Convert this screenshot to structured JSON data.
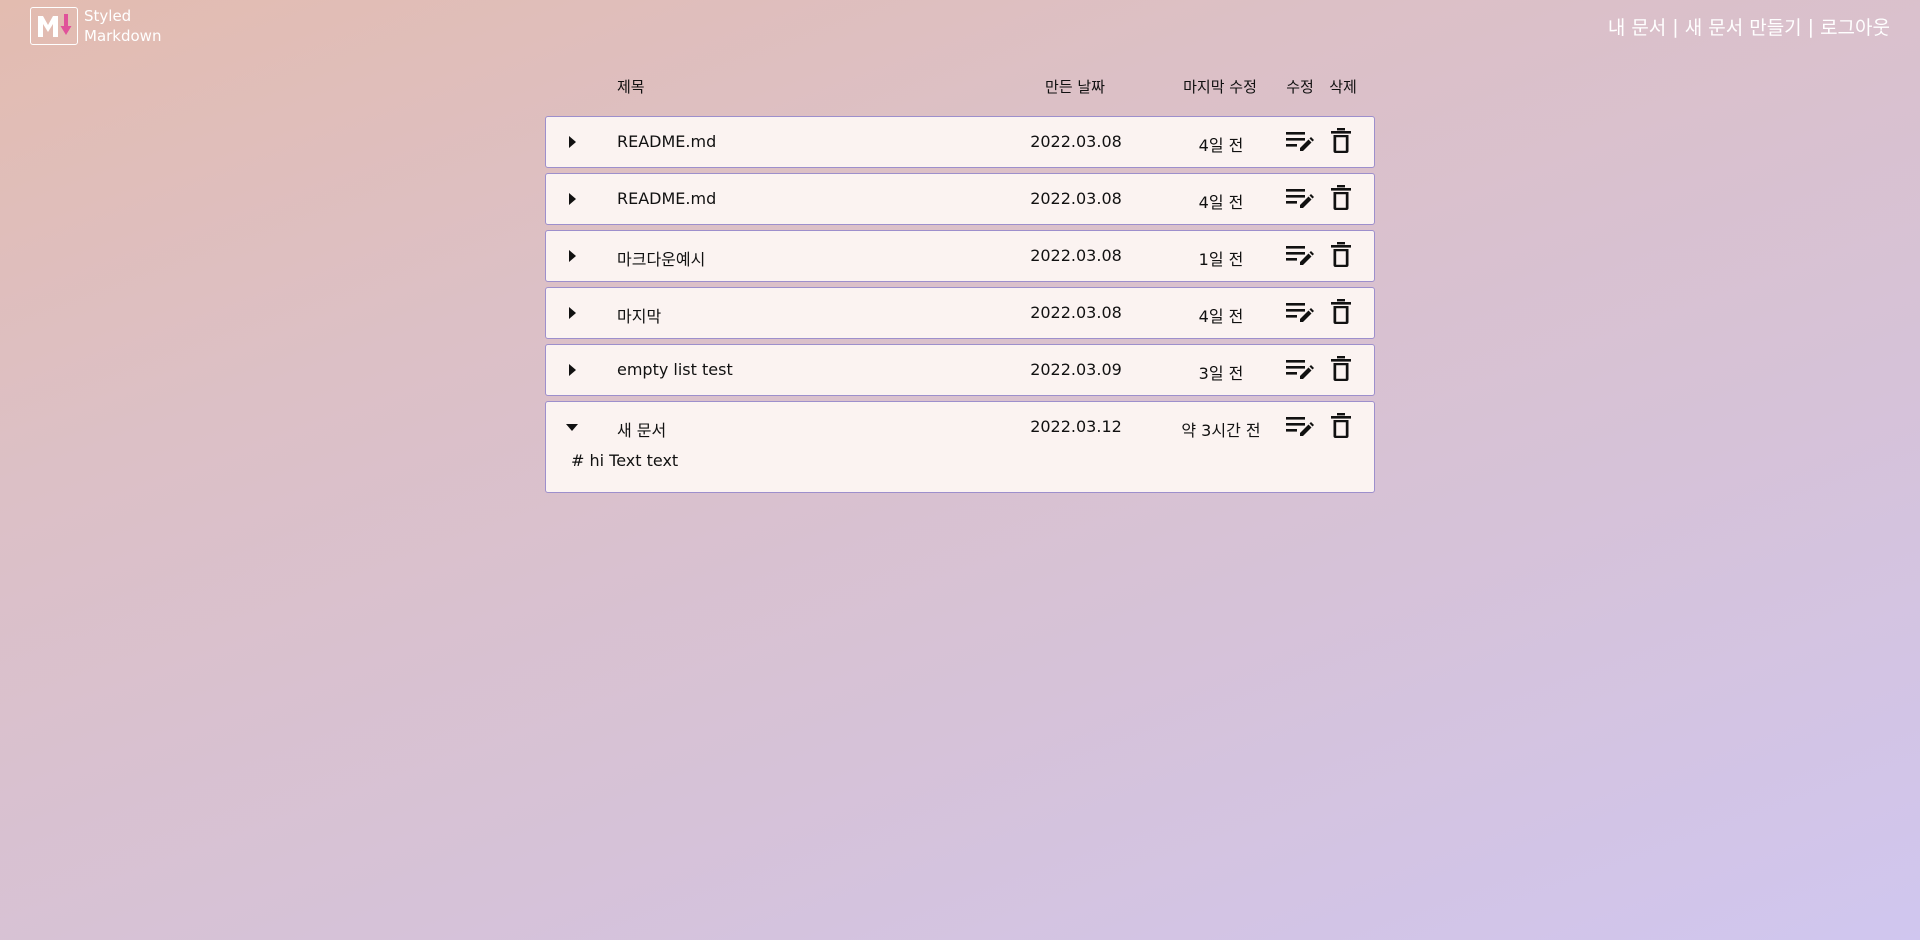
{
  "app": {
    "logo_line1": "Styled",
    "logo_line2": "Markdown"
  },
  "nav": {
    "my_docs": "내 문서",
    "new_doc": "새 문서 만들기",
    "logout": "로그아웃",
    "separator": "|"
  },
  "columns": {
    "title": "제목",
    "created": "만든 날짜",
    "modified": "마지막 수정",
    "edit": "수정",
    "delete": "삭제"
  },
  "documents": [
    {
      "title": "README.md",
      "created": "2022.03.08",
      "modified": "4일 전",
      "expanded": false
    },
    {
      "title": "README.md",
      "created": "2022.03.08",
      "modified": "4일 전",
      "expanded": false
    },
    {
      "title": "마크다운예시",
      "created": "2022.03.08",
      "modified": "1일 전",
      "expanded": false
    },
    {
      "title": "마지막",
      "created": "2022.03.08",
      "modified": "4일 전",
      "expanded": false
    },
    {
      "title": "empty list test",
      "created": "2022.03.09",
      "modified": "3일 전",
      "expanded": false
    },
    {
      "title": "새 문서",
      "created": "2022.03.12",
      "modified": "약 3시간 전",
      "expanded": true,
      "content": "# hi Text text"
    }
  ],
  "icons": {
    "logo": "markdown-logo-icon",
    "collapsed": "caret-right-icon",
    "expanded": "caret-down-icon",
    "edit": "edit-note-icon",
    "delete": "trash-icon"
  },
  "colors": {
    "card_bg": "#fbf3f1",
    "card_border": "#9d8fcc",
    "nav_text": "#ffffff",
    "logo_accent": "#e0529a"
  }
}
